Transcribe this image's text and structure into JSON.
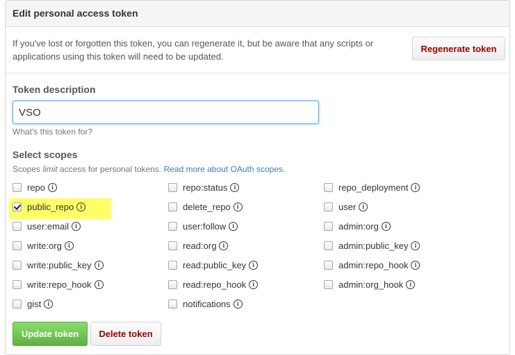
{
  "panel": {
    "title": "Edit personal access token"
  },
  "regenerate": {
    "text": "If you've lost or forgotten this token, you can regenerate it, but be aware that any scripts or applications using this token will need to be updated.",
    "button": "Regenerate token"
  },
  "description": {
    "label": "Token description",
    "value": "VSO",
    "hint": "What's this token for?"
  },
  "scopes": {
    "label": "Select scopes",
    "note_prefix": "Scopes ",
    "note_em": "limit",
    "note_mid": " access for personal tokens. ",
    "note_link": "Read more about OAuth scopes.",
    "items": [
      {
        "label": "repo",
        "checked": false
      },
      {
        "label": "repo:status",
        "checked": false
      },
      {
        "label": "repo_deployment",
        "checked": false
      },
      {
        "label": "public_repo",
        "checked": true
      },
      {
        "label": "delete_repo",
        "checked": false
      },
      {
        "label": "user",
        "checked": false
      },
      {
        "label": "user:email",
        "checked": false
      },
      {
        "label": "user:follow",
        "checked": false
      },
      {
        "label": "admin:org",
        "checked": false
      },
      {
        "label": "write:org",
        "checked": false
      },
      {
        "label": "read:org",
        "checked": false
      },
      {
        "label": "admin:public_key",
        "checked": false
      },
      {
        "label": "write:public_key",
        "checked": false
      },
      {
        "label": "read:public_key",
        "checked": false
      },
      {
        "label": "admin:repo_hook",
        "checked": false
      },
      {
        "label": "write:repo_hook",
        "checked": false
      },
      {
        "label": "read:repo_hook",
        "checked": false
      },
      {
        "label": "admin:org_hook",
        "checked": false
      },
      {
        "label": "gist",
        "checked": false
      },
      {
        "label": "notifications",
        "checked": false
      }
    ],
    "info_icon": "info-circle-icon",
    "highlight_color": "#ffff66"
  },
  "actions": {
    "update": "Update token",
    "delete": "Delete token"
  }
}
